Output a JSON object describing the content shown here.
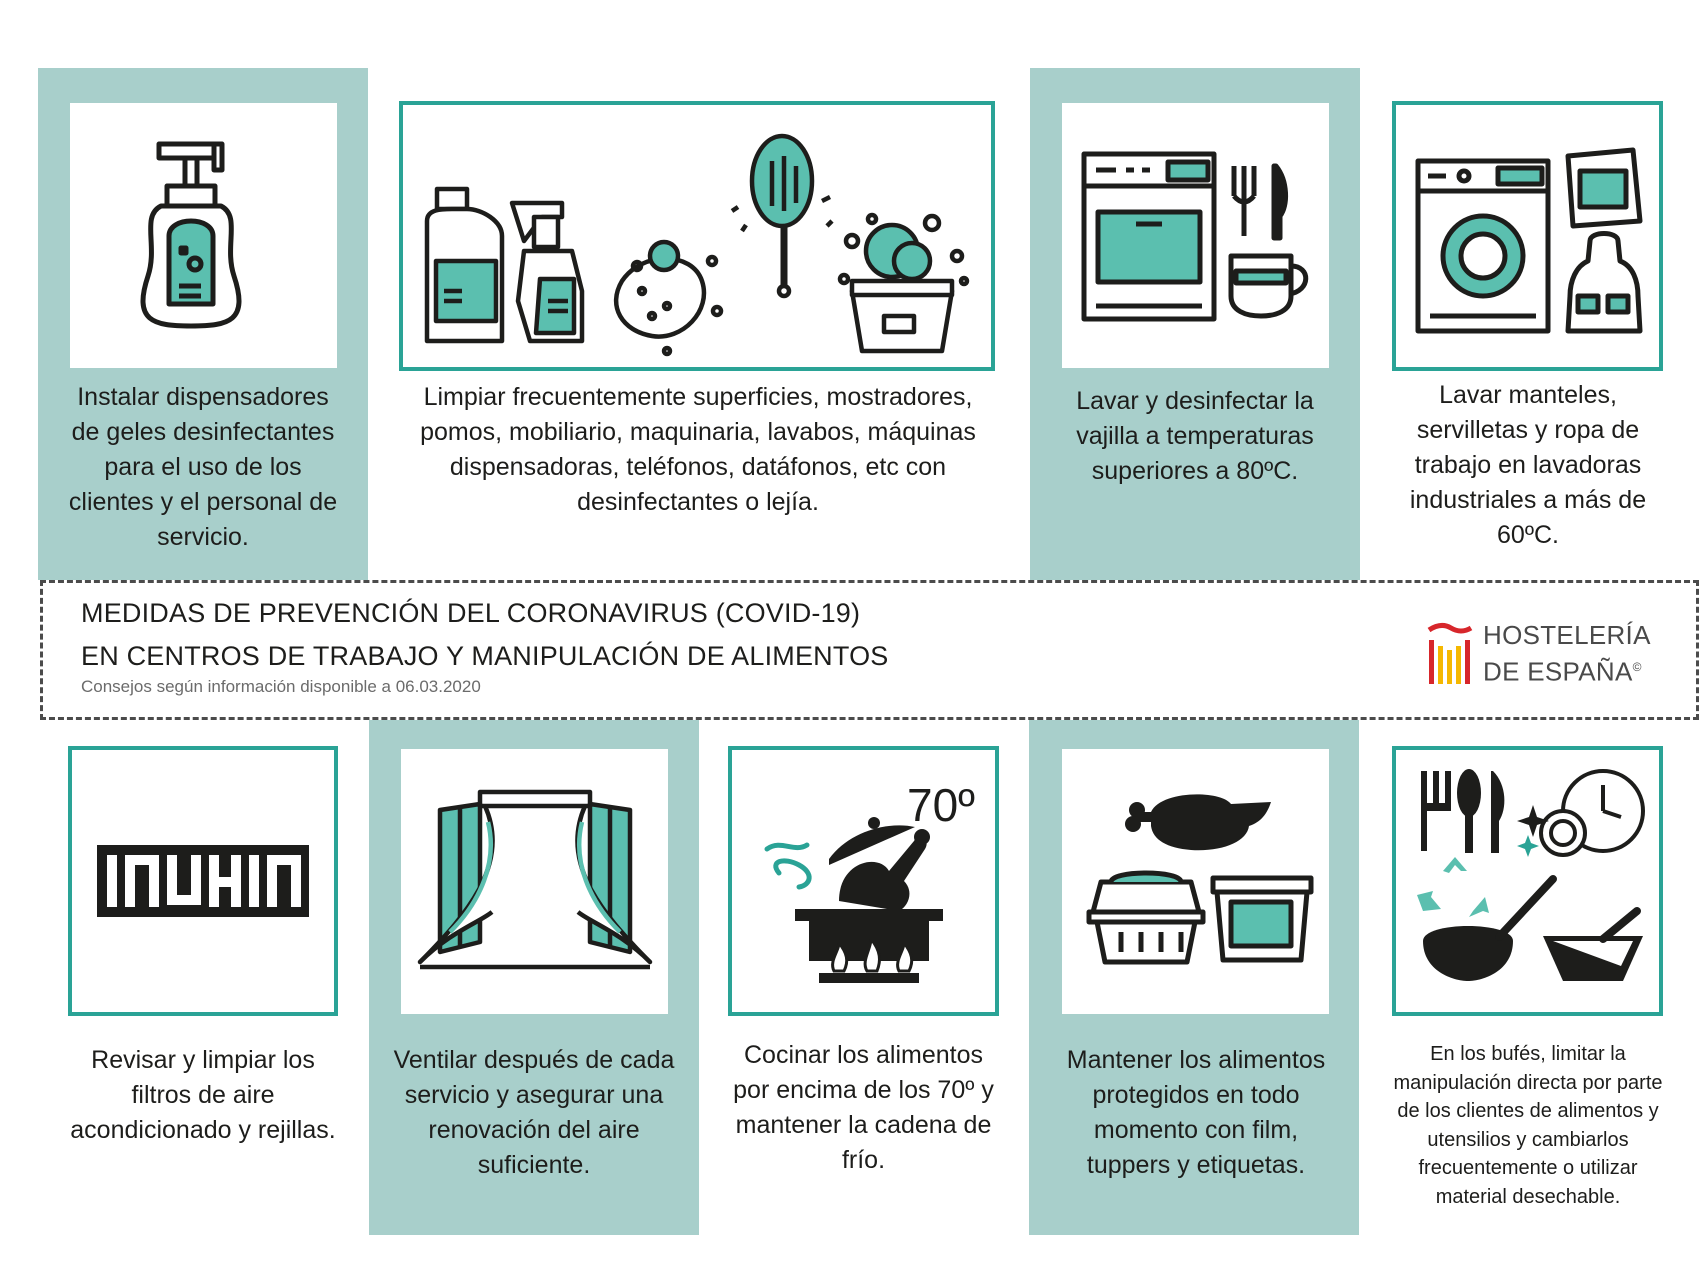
{
  "items": [
    {
      "caption": "Instalar dispensadores de geles desinfectantes para el uso de los clientes y el personal de servicio.",
      "icon": "soap-dispenser-icon"
    },
    {
      "caption": "Limpiar frecuentemente superficies, mostradores, pomos, mobiliario, maquinaria, lavabos, máquinas dispensadoras, teléfonos, datáfonos, etc con desinfectantes o lejía.",
      "icon": "cleaning-products-icon"
    },
    {
      "caption": "Lavar y desinfectar la vajilla a temperaturas superiores a 80ºC.",
      "icon": "dishwasher-icon"
    },
    {
      "caption": "Lavar manteles, servilletas y ropa de trabajo en lavadoras industriales a más de 60ºC.",
      "icon": "washing-machine-icon"
    },
    {
      "caption": "Revisar y limpiar los filtros de aire acondicionado y rejillas.",
      "icon": "air-filter-icon"
    },
    {
      "caption": "Ventilar después de cada servicio y asegurar una renovación del aire suficiente.",
      "icon": "window-ventilation-icon"
    },
    {
      "caption": "Cocinar los alimentos por encima de los 70º y mantener la cadena de frío.",
      "icon": "cooking-pot-icon",
      "temp_label": "70º"
    },
    {
      "caption": "Mantener los alimentos protegidos en todo momento con film, tuppers y etiquetas.",
      "icon": "food-containers-icon"
    },
    {
      "caption": "En los bufés, limitar la manipulación directa por parte de los clientes de alimentos y utensilios y cambiarlos frecuentemente o utilizar material desechable.",
      "icon": "buffet-utensils-icon"
    }
  ],
  "banner": {
    "title_line1": "MEDIDAS DE PREVENCIÓN DEL CORONAVIRUS (COVID-19)",
    "title_line2": "EN CENTROS DE TRABAJO Y MANIPULACIÓN DE ALIMENTOS",
    "subtitle": "Consejos según información disponible a 06.03.2020"
  },
  "logo": {
    "line1": "HOSTELERÍA",
    "line2": "DE ESPAÑA",
    "mark": "©"
  },
  "colors": {
    "teal": "#5bbfaf",
    "teal_border": "#2aa396",
    "panel_bg": "#a8cfcb",
    "ink": "#1d1d1b",
    "logo_red": "#d7262b",
    "logo_yellow": "#f5b800"
  }
}
